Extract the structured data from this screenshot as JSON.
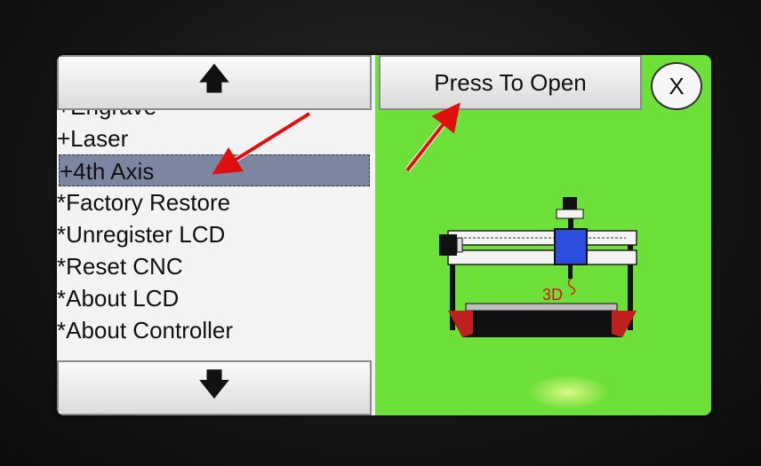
{
  "menu": {
    "up_icon": "up-arrow-icon",
    "up_glyph": "🡅",
    "down_icon": "down-arrow-icon",
    "down_glyph": "🡇",
    "partial_item": "+Engrave",
    "items": [
      {
        "label": "+Laser",
        "selected": false
      },
      {
        "label": "+4th Axis",
        "selected": true
      },
      {
        "label": "*Factory Restore",
        "selected": false
      },
      {
        "label": "*Unregister LCD",
        "selected": false
      },
      {
        "label": "*Reset CNC",
        "selected": false
      },
      {
        "label": "*About LCD",
        "selected": false
      },
      {
        "label": "*About Controller",
        "selected": false
      }
    ]
  },
  "right_panel": {
    "open_button_label": "Press To Open",
    "close_button_label": "X",
    "machine_label": "3D"
  },
  "colors": {
    "screen_bg": "#6ee03a",
    "selected_row": "#7d86a0",
    "annotation_arrow": "#e01010",
    "carriage": "#2d4de0",
    "bed_accent": "#c02020"
  }
}
